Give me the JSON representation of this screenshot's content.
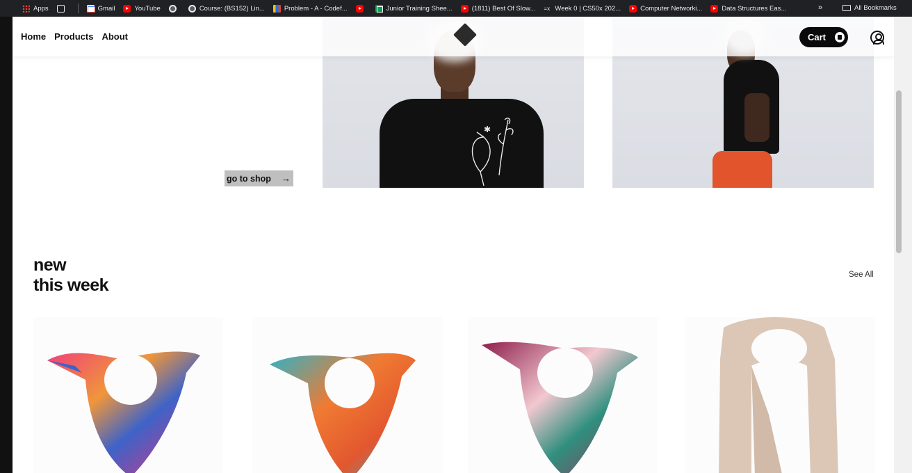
{
  "bookmarks": [
    {
      "icon": "apps-icon",
      "label": "Apps"
    },
    {
      "icon": "grid-icon",
      "label": ""
    },
    {
      "icon": "gmail-icon",
      "label": "Gmail"
    },
    {
      "icon": "youtube-icon",
      "label": "YouTube"
    },
    {
      "icon": "globe-icon",
      "label": ""
    },
    {
      "icon": "globe-icon",
      "label": "Course: (BS152) Lin..."
    },
    {
      "icon": "codeforces-icon",
      "label": "Problem - A - Codef..."
    },
    {
      "icon": "youtube-icon",
      "label": ""
    },
    {
      "icon": "sheets-icon",
      "label": "Junior Training Shee..."
    },
    {
      "icon": "youtube-icon",
      "label": "(1811) Best Of Slow..."
    },
    {
      "icon": "cs50-icon",
      "label": "Week 0 | CS50x 202..."
    },
    {
      "icon": "youtube-icon",
      "label": "Computer Networki..."
    },
    {
      "icon": "youtube-icon",
      "label": "Data Structures Eas..."
    }
  ],
  "bookmarks_more": "»",
  "all_bookmarks": "All Bookmarks",
  "nav": {
    "home": "Home",
    "products": "Products",
    "about": "About"
  },
  "cart_label": "Cart",
  "hero": {
    "shop_button": "go to shop",
    "shop_arrow": "→"
  },
  "section": {
    "title_line1": "new",
    "title_line2": "this week",
    "see_all": "See All"
  },
  "colors": {
    "accent": "#0a0a0a",
    "button_bg": "#bfbfbf",
    "hero_bg": "#e0e2e7"
  }
}
